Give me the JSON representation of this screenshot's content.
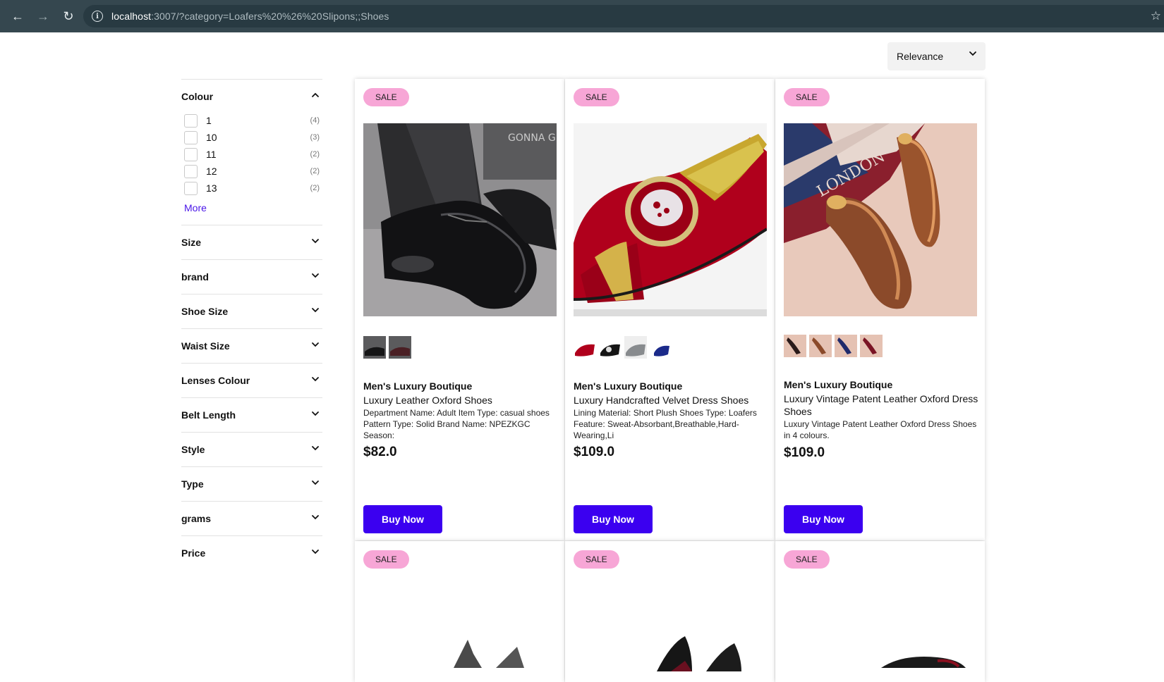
{
  "browser": {
    "url_host": "localhost",
    "url_rest": ":3007/?category=Loafers%20%26%20Slipons;;Shoes"
  },
  "sort": {
    "selected": "Relevance"
  },
  "sidebar": {
    "colour": {
      "title": "Colour",
      "options": [
        {
          "label": "1",
          "count": "(4)"
        },
        {
          "label": "10",
          "count": "(3)"
        },
        {
          "label": "11",
          "count": "(2)"
        },
        {
          "label": "12",
          "count": "(2)"
        },
        {
          "label": "13",
          "count": "(2)"
        }
      ],
      "more": "More"
    },
    "filters": [
      "Size",
      "brand",
      "Shoe Size",
      "Waist Size",
      "Lenses Colour",
      "Belt Length",
      "Style",
      "Type",
      "grams",
      "Price"
    ]
  },
  "products": [
    {
      "badge": "SALE",
      "brand": "Men's Luxury Boutique",
      "name": "Luxury Leather Oxford Shoes",
      "desc": "Department Name: Adult Item Type: casual shoes Pattern Type: Solid Brand Name: NPEZKGC Season:",
      "price": "$82.0",
      "buy": "Buy Now"
    },
    {
      "badge": "SALE",
      "brand": "Men's Luxury Boutique",
      "name": "Luxury Handcrafted Velvet Dress Shoes",
      "desc": "Lining Material: Short Plush Shoes Type: Loafers Feature: Sweat-Absorbant,Breathable,Hard-Wearing,Li",
      "price": "$109.0",
      "buy": "Buy Now"
    },
    {
      "badge": "SALE",
      "brand": "Men's Luxury Boutique",
      "name": "Luxury Vintage Patent Leather Oxford Dress Shoes",
      "desc": "Luxury Vintage Patent Leather Oxford Dress Shoes in 4 colours.",
      "price": "$109.0",
      "buy": "Buy Now"
    }
  ],
  "products_row2": [
    {
      "badge": "SALE"
    },
    {
      "badge": "SALE"
    },
    {
      "badge": "SALE"
    }
  ],
  "colors": {
    "accent": "#3b00f0",
    "badge": "#f7a6d6",
    "link": "#4b17e8",
    "chrome": "#35474f"
  }
}
